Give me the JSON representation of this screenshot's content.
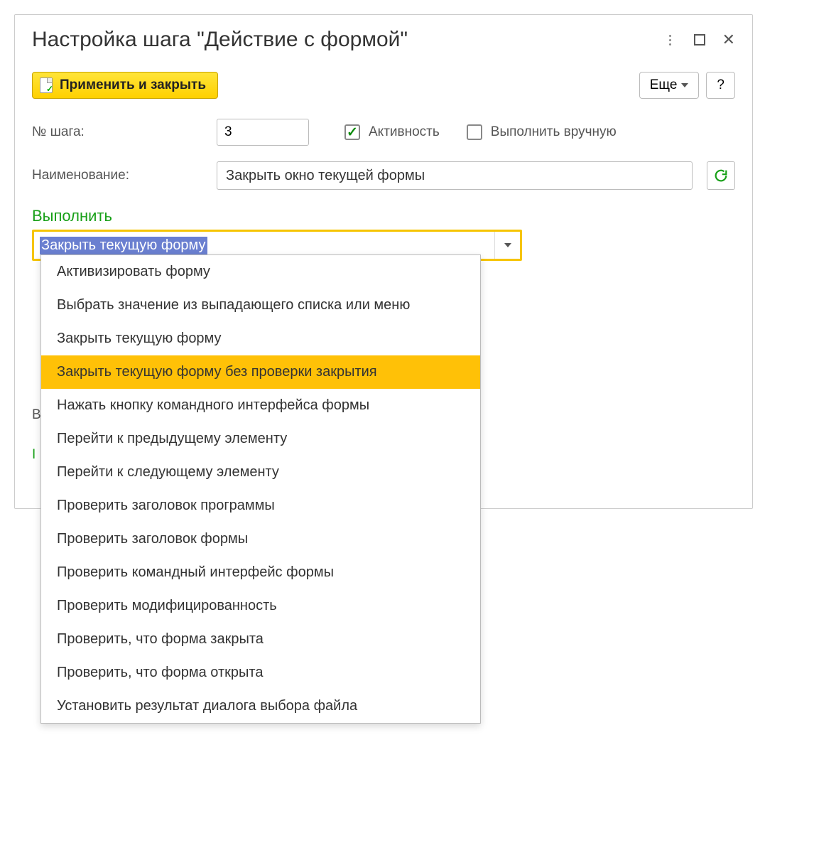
{
  "header": {
    "title": "Настройка шага \"Действие с формой\""
  },
  "toolbar": {
    "apply_label": "Применить и закрыть",
    "more_label": "Еще",
    "help_label": "?"
  },
  "fields": {
    "step_label": "№ шага:",
    "step_value": "3",
    "active_label": "Активность",
    "manual_label": "Выполнить вручную",
    "name_label": "Наименование:",
    "name_value": "Закрыть окно текущей формы"
  },
  "execute": {
    "label": "Выполнить",
    "selected": "Закрыть текущую форму",
    "options": [
      "Активизировать форму",
      "Выбрать значение из выпадающего списка или меню",
      "Закрыть текущую форму",
      "Закрыть текущую форму без проверки закрытия",
      "Нажать кнопку командного интерфейса формы",
      "Перейти к предыдущему элементу",
      "Перейти к следующему элементу",
      "Проверить заголовок программы",
      "Проверить заголовок формы",
      "Проверить командный интерфейс формы",
      "Проверить модифицированность",
      "Проверить, что форма закрыта",
      "Проверить, что форма открыта",
      "Установить результат диалога выбора файла"
    ],
    "highlight_index": 3
  },
  "obscured": {
    "line1": "В",
    "line2": "І"
  }
}
